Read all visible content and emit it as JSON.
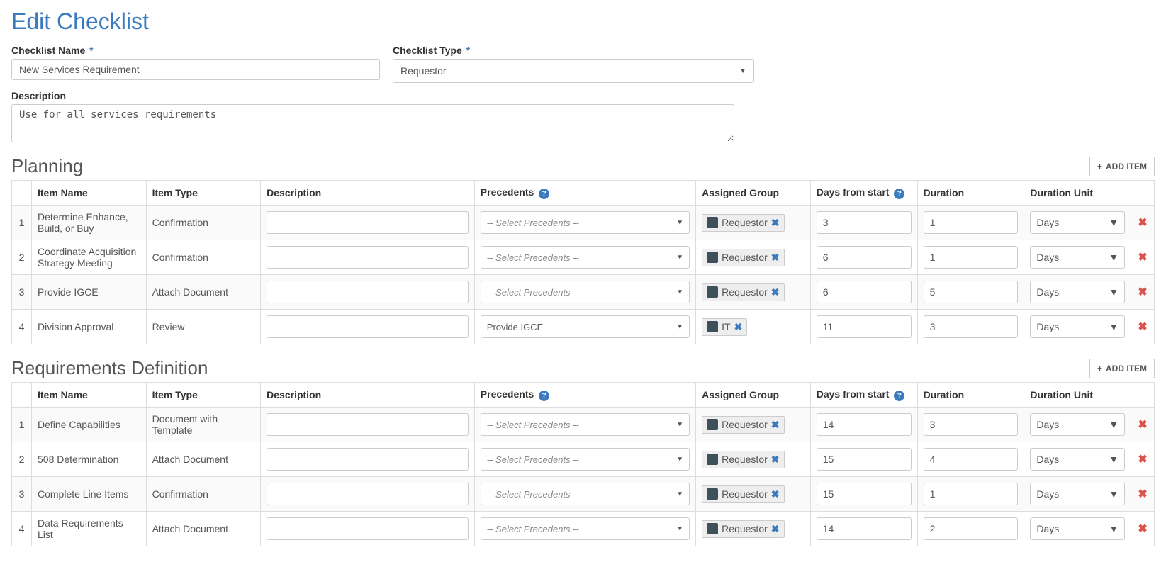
{
  "page": {
    "title": "Edit Checklist"
  },
  "fields": {
    "checklist_name": {
      "label": "Checklist Name",
      "required": "*",
      "value": "New Services Requirement"
    },
    "checklist_type": {
      "label": "Checklist Type",
      "required": "*",
      "value": "Requestor"
    },
    "description": {
      "label": "Description",
      "value": "Use for all services requirements"
    }
  },
  "columns": {
    "item_name": "Item Name",
    "item_type": "Item Type",
    "description": "Description",
    "precedents": "Precedents",
    "assigned_group": "Assigned Group",
    "days_from_start": "Days from start",
    "duration": "Duration",
    "duration_unit": "Duration Unit"
  },
  "placeholders": {
    "select_precedents": "-- Select Precedents --"
  },
  "buttons": {
    "add_item": "ADD ITEM"
  },
  "sections": [
    {
      "title": "Planning",
      "rows": [
        {
          "num": "1",
          "name": "Determine Enhance, Build, or Buy",
          "type": "Confirmation",
          "description": "",
          "precedent": "",
          "assigned": "Requestor",
          "days": "3",
          "duration": "1",
          "unit": "Days"
        },
        {
          "num": "2",
          "name": "Coordinate Acquisition Strategy Meeting",
          "type": "Confirmation",
          "description": "",
          "precedent": "",
          "assigned": "Requestor",
          "days": "6",
          "duration": "1",
          "unit": "Days"
        },
        {
          "num": "3",
          "name": "Provide IGCE",
          "type": "Attach Document",
          "description": "",
          "precedent": "",
          "assigned": "Requestor",
          "days": "6",
          "duration": "5",
          "unit": "Days"
        },
        {
          "num": "4",
          "name": "Division Approval",
          "type": "Review",
          "description": "",
          "precedent": "Provide IGCE",
          "assigned": "IT",
          "days": "11",
          "duration": "3",
          "unit": "Days"
        }
      ]
    },
    {
      "title": "Requirements Definition",
      "rows": [
        {
          "num": "1",
          "name": "Define Capabilities",
          "type": "Document with Template",
          "description": "",
          "precedent": "",
          "assigned": "Requestor",
          "days": "14",
          "duration": "3",
          "unit": "Days"
        },
        {
          "num": "2",
          "name": "508 Determination",
          "type": "Attach Document",
          "description": "",
          "precedent": "",
          "assigned": "Requestor",
          "days": "15",
          "duration": "4",
          "unit": "Days"
        },
        {
          "num": "3",
          "name": "Complete Line Items",
          "type": "Confirmation",
          "description": "",
          "precedent": "",
          "assigned": "Requestor",
          "days": "15",
          "duration": "1",
          "unit": "Days"
        },
        {
          "num": "4",
          "name": "Data Requirements List",
          "type": "Attach Document",
          "description": "",
          "precedent": "",
          "assigned": "Requestor",
          "days": "14",
          "duration": "2",
          "unit": "Days"
        }
      ]
    }
  ]
}
